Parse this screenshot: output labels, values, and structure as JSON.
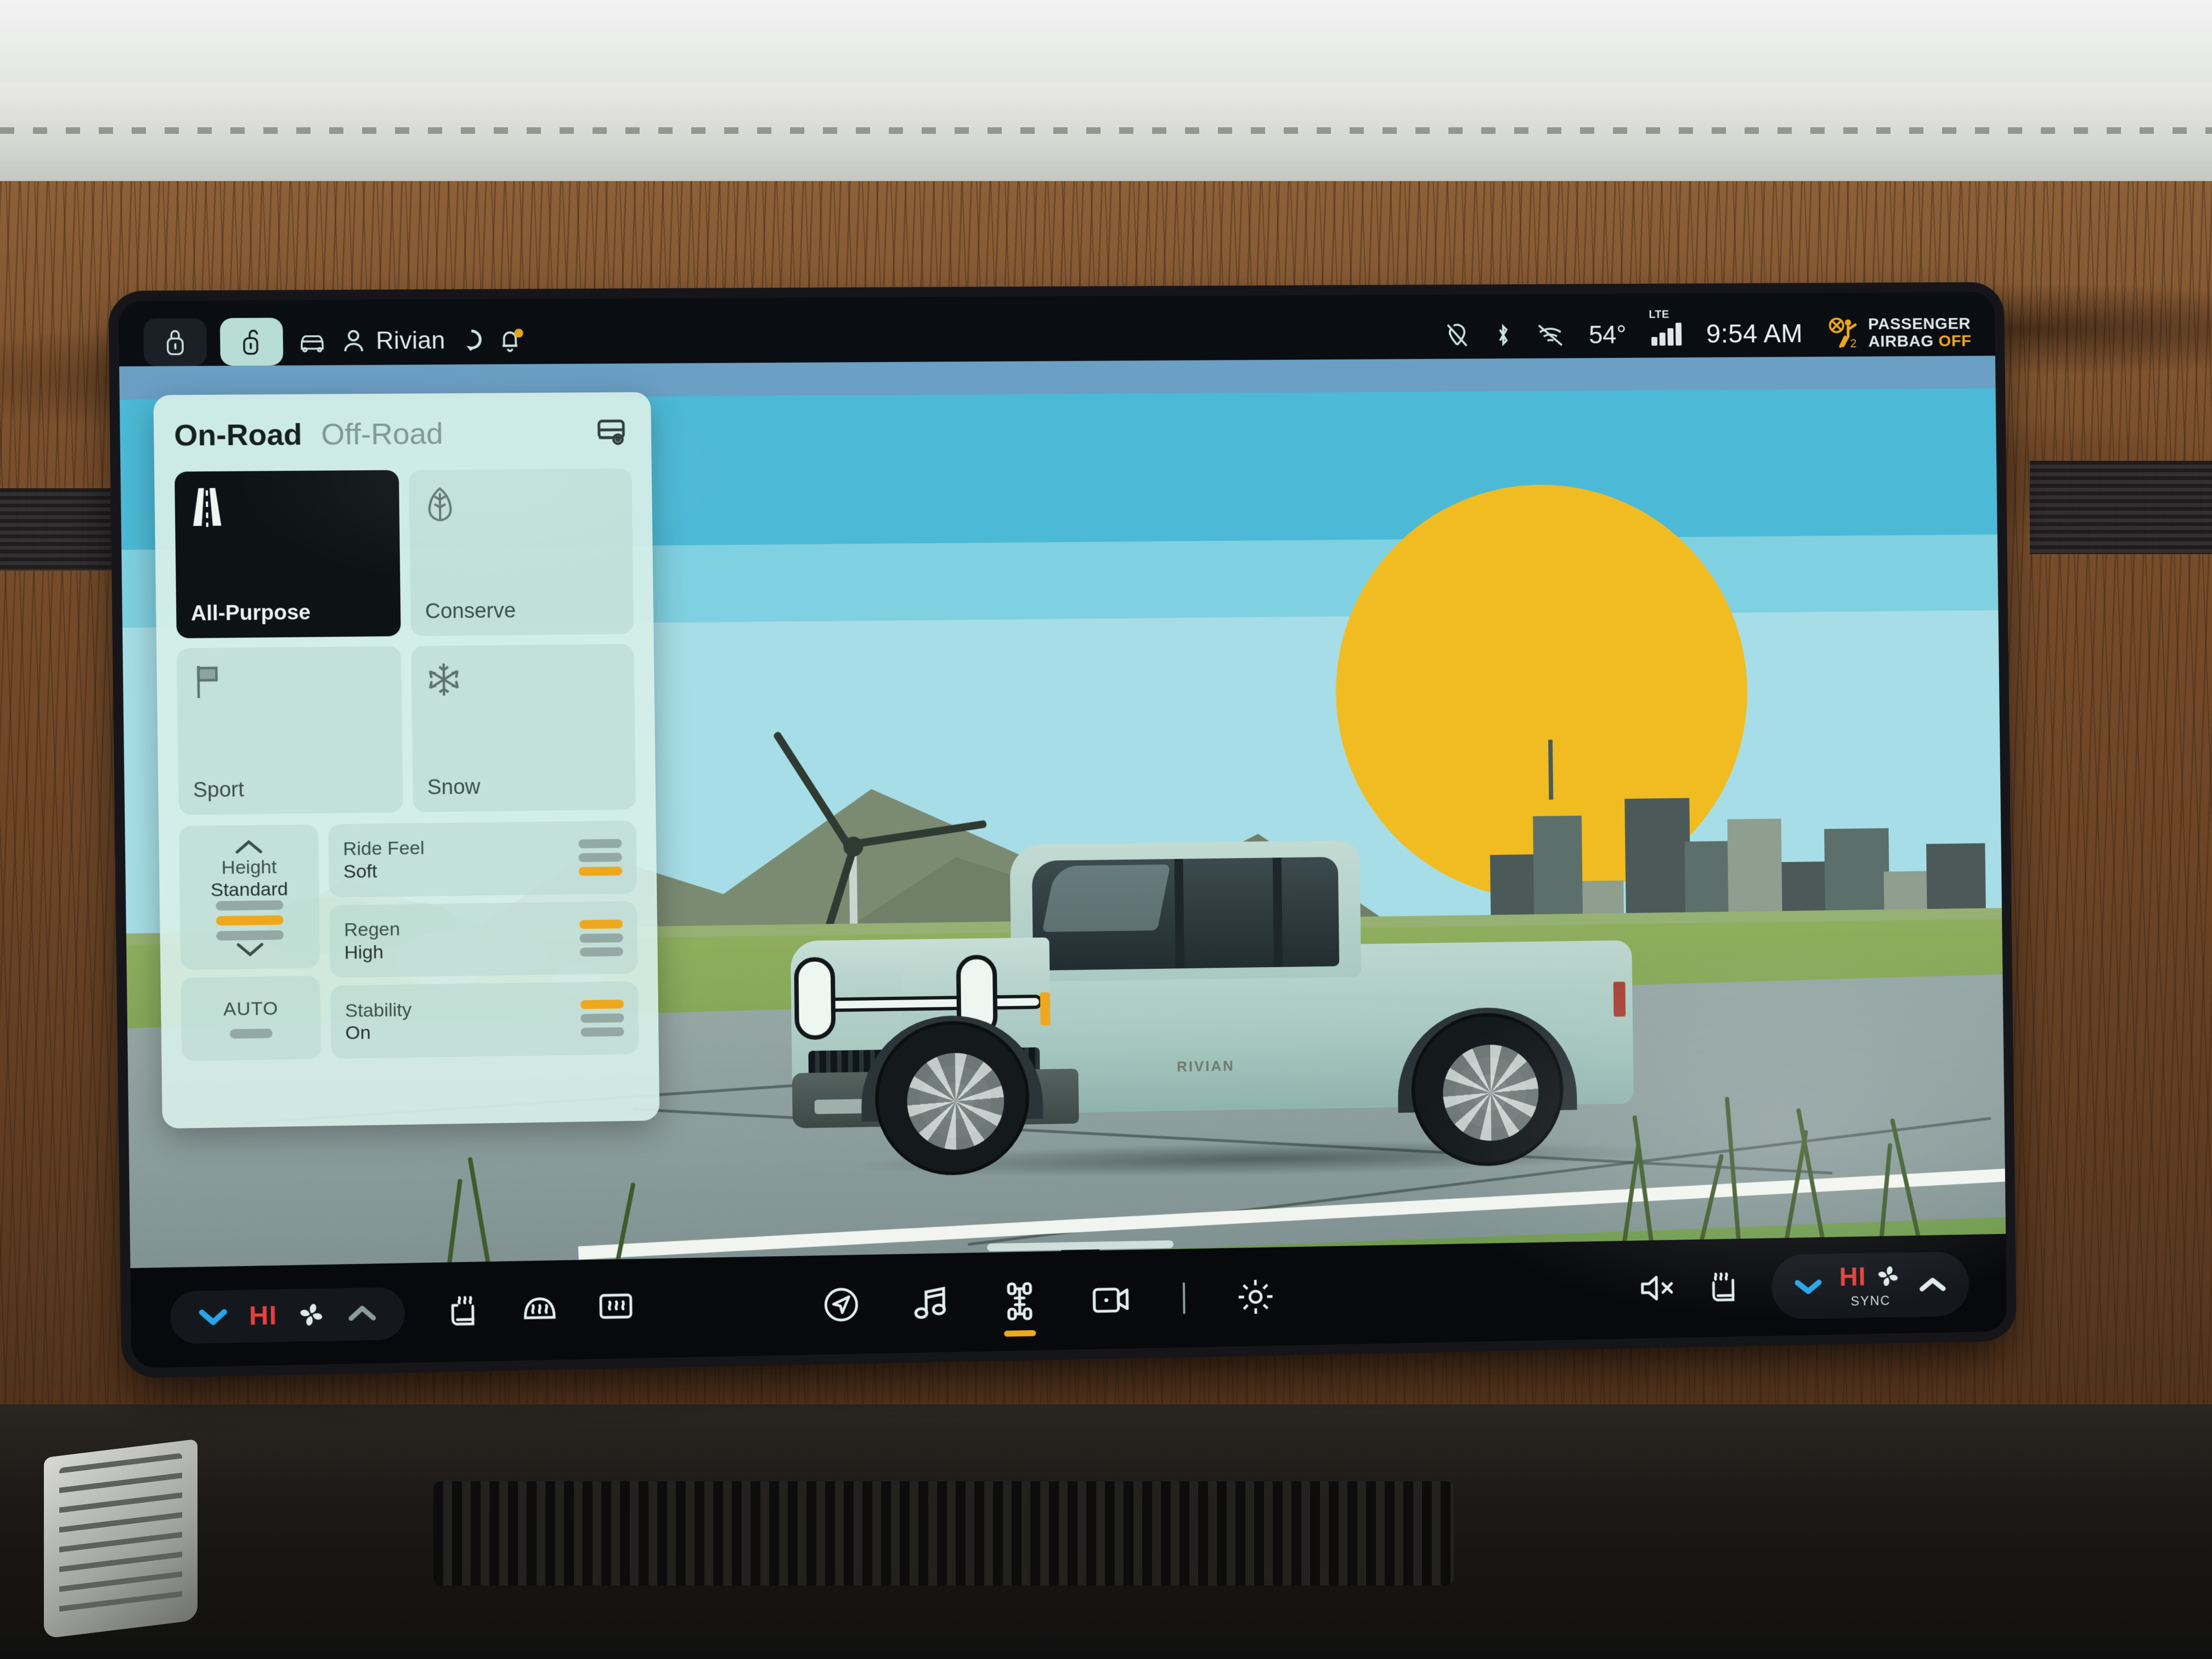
{
  "status_bar": {
    "lock_icon": "lock-closed-icon",
    "unlock_icon": "lock-open-icon",
    "car_icon": "car-icon",
    "profile_icon": "person-icon",
    "profile_name": "Rivian",
    "ring_icon": "ring-icon",
    "bell_icon": "bell-icon",
    "location_off_icon": "location-off-icon",
    "bluetooth_icon": "bluetooth-icon",
    "wifi_off_icon": "wifi-off-icon",
    "temperature": "54°",
    "network_label": "LTE",
    "signal_bars": 4,
    "time": "9:54 AM",
    "airbag_line1": "PASSENGER",
    "airbag_line2": "AIRBAG",
    "airbag_state": "OFF",
    "airbag_seat_number": "2"
  },
  "drive_panel": {
    "tabs": [
      {
        "label": "On-Road",
        "selected": true
      },
      {
        "label": "Off-Road",
        "selected": false
      }
    ],
    "trailer_icon": "trailer-icon",
    "modes": [
      {
        "label": "All-Purpose",
        "icon": "road-icon",
        "selected": true
      },
      {
        "label": "Conserve",
        "icon": "leaf-icon",
        "selected": false
      },
      {
        "label": "Sport",
        "icon": "flag-icon",
        "selected": false
      },
      {
        "label": "Snow",
        "icon": "snowflake-icon",
        "selected": false
      }
    ],
    "height": {
      "title": "Height",
      "value": "Standard",
      "up_icon": "chevron-up-icon",
      "down_icon": "chevron-down-icon",
      "segments": 3,
      "active_index": 1
    },
    "auto": {
      "label": "AUTO",
      "active": false
    },
    "settings": [
      {
        "title": "Ride Feel",
        "value": "Soft",
        "segments": 3,
        "active_index": 2
      },
      {
        "title": "Regen",
        "value": "High",
        "segments": 3,
        "active_index": 0
      },
      {
        "title": "Stability",
        "value": "On",
        "segments": 3,
        "active_index": 0
      }
    ]
  },
  "dock": {
    "left_climate": {
      "down_icon": "chevron-down-icon",
      "temp_label": "HI",
      "fan_icon": "fan-icon",
      "up_icon": "chevron-up-icon"
    },
    "left_icons": [
      {
        "icon": "heated-seat-icon"
      },
      {
        "icon": "front-defrost-icon"
      },
      {
        "icon": "rear-defrost-icon"
      }
    ],
    "center_icons": [
      {
        "icon": "navigation-icon",
        "active": false
      },
      {
        "icon": "music-icon",
        "active": false
      },
      {
        "icon": "drive-chassis-icon",
        "active": true
      },
      {
        "icon": "camera-icon",
        "active": false
      },
      {
        "icon": "divider",
        "active": false
      },
      {
        "icon": "gear-icon",
        "active": false
      }
    ],
    "right_icons": [
      {
        "icon": "mute-icon"
      },
      {
        "icon": "heated-seat-icon"
      }
    ],
    "right_climate": {
      "down_icon": "chevron-down-icon",
      "temp_label": "HI",
      "fan_icon": "fan-icon",
      "sync_label": "SYNC"
    }
  },
  "scene": {
    "vehicle_badge": "RIVIAN",
    "colors": {
      "accent_orange": "#efa81d",
      "sun_yellow": "#f0bc21",
      "panel_bg": "#d6eee7",
      "selected_tile": "#0d1315",
      "sky_top": "#6b9fc4",
      "sky_mid": "#4cb9d6",
      "sky_low": "#a7dde6",
      "truck_body": "#b0cec6",
      "grass": "#7da355",
      "road": "#8a9c9b",
      "hi_red": "#e8403a",
      "chevron_blue": "#2aa3e8"
    }
  }
}
